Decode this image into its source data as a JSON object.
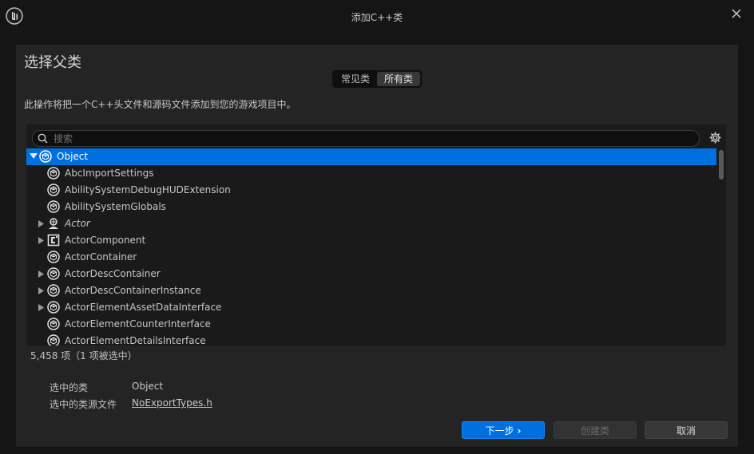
{
  "window": {
    "title": "添加C++类"
  },
  "header": {
    "title": "选择父类"
  },
  "tabs": [
    {
      "label": "常见类",
      "active": false
    },
    {
      "label": "所有类",
      "active": true
    }
  ],
  "description": "此操作将把一个C++头文件和源码文件添加到您的游戏项目中。",
  "search": {
    "placeholder": "搜索",
    "value": ""
  },
  "tree": [
    {
      "label": "Object",
      "icon": "object-icon",
      "expanded": true,
      "has_children": true,
      "selected": true,
      "italic": false
    },
    {
      "label": "AbcImportSettings",
      "icon": "object-icon",
      "has_children": false
    },
    {
      "label": "AbilitySystemDebugHUDExtension",
      "icon": "object-icon",
      "has_children": false
    },
    {
      "label": "AbilitySystemGlobals",
      "icon": "object-icon",
      "has_children": false
    },
    {
      "label": "Actor",
      "icon": "actor-icon",
      "has_children": true,
      "italic": true
    },
    {
      "label": "ActorComponent",
      "icon": "component-icon",
      "has_children": true
    },
    {
      "label": "ActorContainer",
      "icon": "object-icon",
      "has_children": false
    },
    {
      "label": "ActorDescContainer",
      "icon": "object-icon",
      "has_children": true
    },
    {
      "label": "ActorDescContainerInstance",
      "icon": "object-icon",
      "has_children": true
    },
    {
      "label": "ActorElementAssetDataInterface",
      "icon": "object-icon",
      "has_children": true
    },
    {
      "label": "ActorElementCounterInterface",
      "icon": "object-icon",
      "has_children": false
    },
    {
      "label": "ActorElementDetailsInterface",
      "icon": "object-icon",
      "has_children": false
    }
  ],
  "status": {
    "count": "5,458 项（1 项被选中）"
  },
  "selection": {
    "class_label": "选中的类",
    "class_value": "Object",
    "source_label": "选中的类源文件",
    "source_value": "NoExportTypes.h"
  },
  "buttons": {
    "next": "下一步",
    "create": "创建类",
    "cancel": "取消"
  },
  "colors": {
    "accent": "#0070e0",
    "background": "#151515",
    "panel": "#242424"
  }
}
